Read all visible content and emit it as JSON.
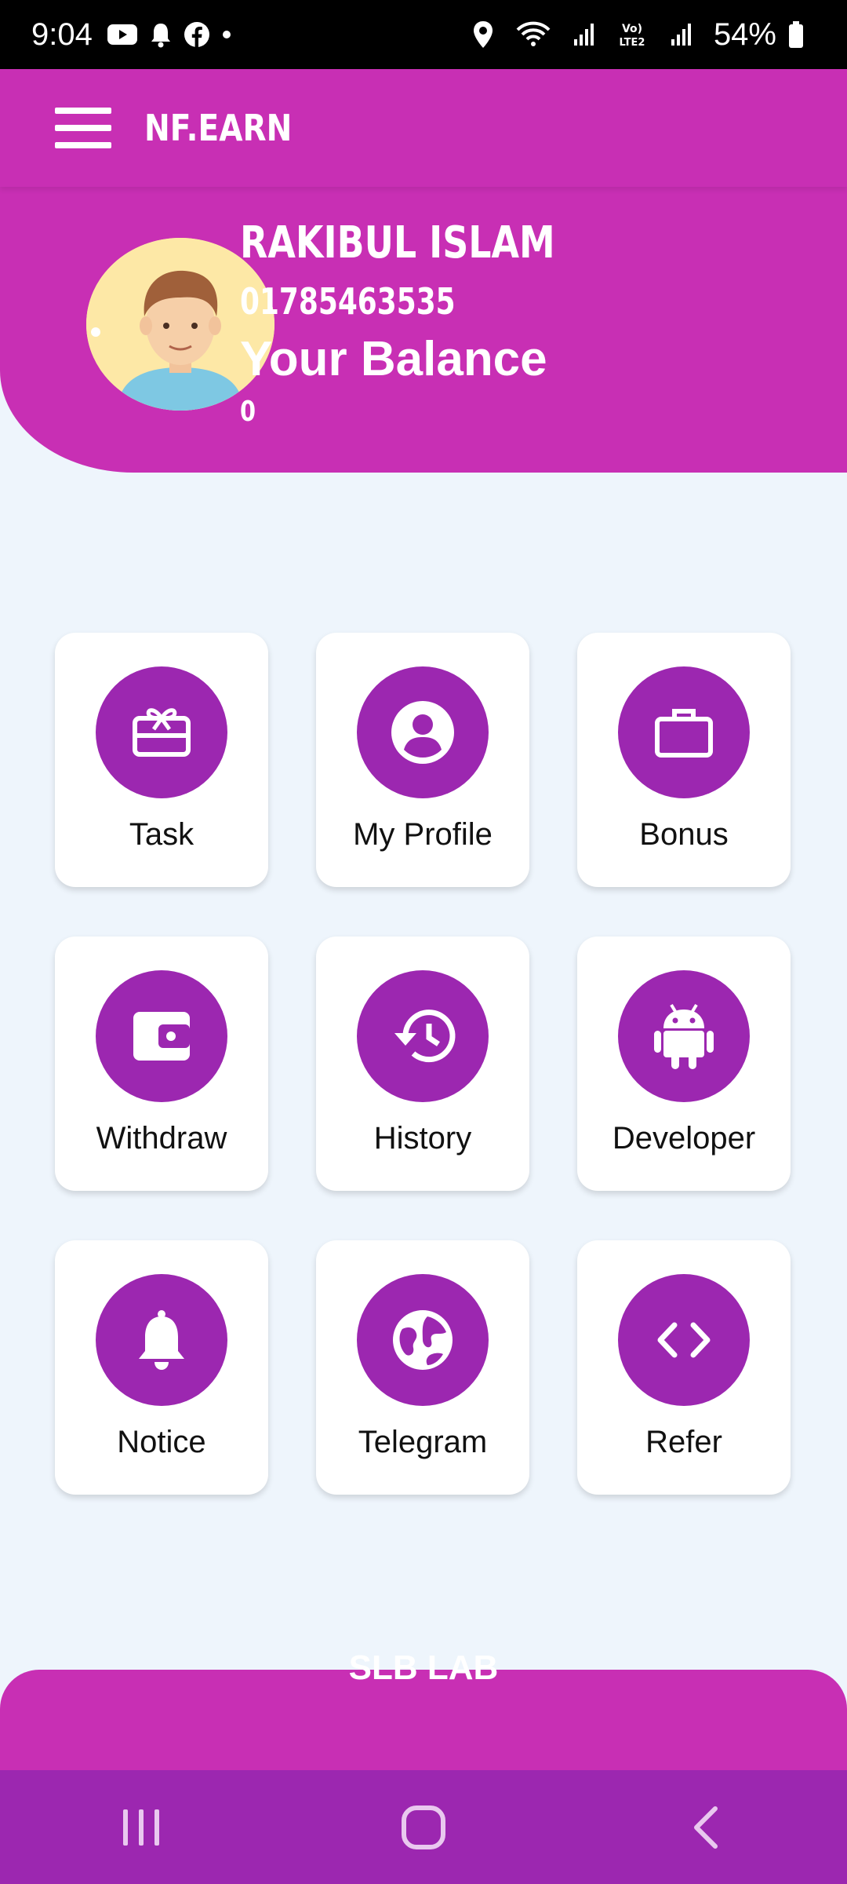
{
  "status_bar": {
    "time": "9:04",
    "battery_percent": "54%",
    "icons": [
      "youtube-icon",
      "bell-icon",
      "facebook-icon",
      "dot-icon",
      "location-icon",
      "wifi-icon",
      "signal-icon",
      "volte-icon",
      "signal-icon",
      "battery-icon"
    ]
  },
  "app_bar": {
    "title": "NF.EARN",
    "menu_icon": "hamburger-menu-icon"
  },
  "profile": {
    "name": "RAKIBUL ISLAM",
    "phone": "01785463535",
    "balance_label": "Your Balance",
    "balance_value": "0",
    "avatar_icon": "user-avatar"
  },
  "menu": {
    "items": [
      {
        "label": "Task",
        "icon": "gift-card-icon"
      },
      {
        "label": "My Profile",
        "icon": "account-circle-icon"
      },
      {
        "label": "Bonus",
        "icon": "briefcase-icon"
      },
      {
        "label": "Withdraw",
        "icon": "wallet-icon"
      },
      {
        "label": "History",
        "icon": "history-icon"
      },
      {
        "label": "Developer",
        "icon": "android-icon"
      },
      {
        "label": "Notice",
        "icon": "bell-icon"
      },
      {
        "label": "Telegram",
        "icon": "globe-icon"
      },
      {
        "label": "Refer",
        "icon": "code-icon"
      }
    ]
  },
  "footer": {
    "text": "SLB LAB"
  },
  "nav_bar": {
    "buttons": [
      "recent-apps-icon",
      "home-icon",
      "back-icon"
    ]
  },
  "colors": {
    "primary": "#c82fb4",
    "icon_circle": "#9c27b0",
    "background": "#eef5fc",
    "nav_bar": "#9c27b0"
  }
}
